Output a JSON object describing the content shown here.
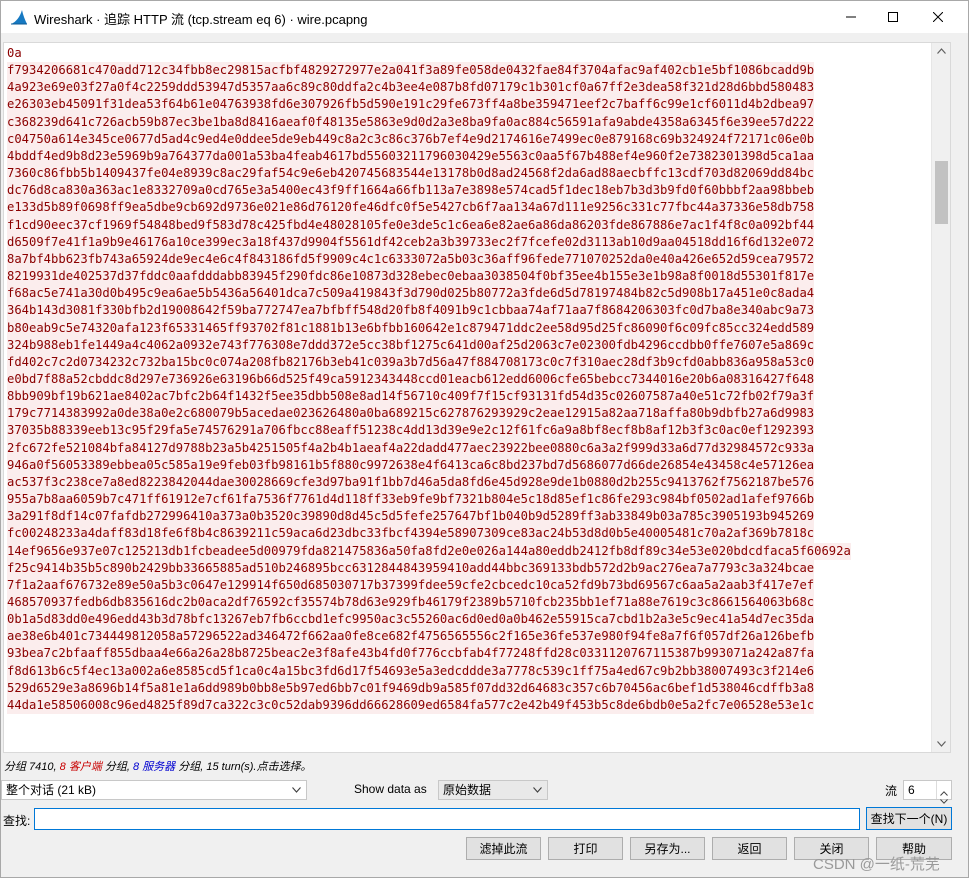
{
  "window": {
    "title": "Wireshark · 追踪 HTTP 流 (tcp.stream eq 6) · wire.pcapng"
  },
  "stream_text": {
    "lines": [
      "0a",
      "f7934206681c470add712c34fbb8ec29815acfbf4829272977e2a041f3a89fe058de0432fae84f3704afac9af402cb1e5bf1086bcadd9b",
      "4a923e69e03f27a0f4c2259ddd53947d5357aa6c89c80ddfa2c4b3ee4e087b8fd07179c1b301cf0a67ff2e3dea58f321d28d6bbd580483",
      "e26303eb45091f31dea53f64b61e04763938fd6e307926fb5d590e191c29fe673ff4a8be359471eef2c7baff6c99e1cf6011d4b2dbea97",
      "c368239d641c726acb59b87ec3be1ba8d8416aeaf0f48135e5863e9d0d2a3e8ba9fa0ac884c56591afa9abde4358a6345f6e39ee57d222",
      "c04750a614e345ce0677d5ad4c9ed4e0ddee5de9eb449c8a2c3c86c376b7ef4e9d2174616e7499ec0e879168c69b324924f72171c06e0b",
      "4bddf4ed9b8d23e5969b9a764377da001a53ba4feab4617bd55603211796030429e5563c0aa5f67b488ef4e960f2e7382301398d5ca1aa",
      "7360c86fbb5b1409437fe04e8939c8ac29faf54c9e6eb420745683544e13178b0d8ad24568f2da6ad88aecbffc13cdf703d82069dd84bc",
      "dc76d8ca830a363ac1e8332709a0cd765e3a5400ec43f9ff1664a66fb113a7e3898e574cad5f1dec18eb7b3d3b9fd0f60bbbf2aa98bbeb",
      "e133d5b89f0698ff9ea5dbe9cb692d9736e021e86d76120fe46dfc0f5e5427cb6f7aa134a67d111e9256c331c77fbc44a37336e58db758",
      "f1cd90eec37cf1969f54848bed9f583d78c425fbd4e48028105fe0e3de5c1c6ea6e82ae6a86da86203fde867886e7ac1f4f8c0a092bf44",
      "d6509f7e41f1a9b9e46176a10ce399ec3a18f437d9904f5561df42ceb2a3b39733ec2f7fcefe02d3113ab10d9aa04518dd16f6d132e072",
      "8a7bf4bb623fb743a65924de9ec4e6c4f843186fd5f9909c4c1c6333072a5b03c36aff96fede771070252da0e40a426e652d59cea79572",
      "8219931de402537d37fddc0aafdddabb83945f290fdc86e10873d328ebec0ebaa3038504f0bf35ee4b155e3e1b98a8f0018d55301f817e",
      "f68ac5e741a30d0b495c9ea6ae5b5436a56401dca7c509a419843f3d790d025b80772a3fde6d5d78197484b82c5d908b17a451e0c8ada4",
      "364b143d3081f330bfb2d19008642f59ba772747ea7bfbff548d20fb8f4091b9c1cbbaa74af71aa7f8684206303fc0d7ba8e340abc9a73",
      "b80eab9c5e74320afa123f65331465ff93702f81c1881b13e6bfbb160642e1c879471ddc2ee58d95d25fc86090f6c09fc85cc324edd589",
      "324b988eb1fe1449a4c4062a0932e743f776308e7ddd372e5cc38bf1275c641d00af25d2063c7e02300fdb4296ccdbb0ffe7607e5a869c",
      "fd402c7c2d0734232c732ba15bc0c074a208fb82176b3eb41c039a3b7d56a47f884708173c0c7f310aec28df3b9cfd0abb836a958a53c0",
      "e0bd7f88a52cbddc8d297e736926e63196b66d525f49ca5912343448ccd01eacb612edd6006cfe65bebcc7344016e20b6a08316427f648",
      "8bb909bf19b621ae8402ac7bfc2b64f1432f5ee35dbb508e8ad14f56710c409f7f15cf93131fd54d35c02607587a40e51c72fb02f79a3f",
      "179c7714383992a0de38a0e2c680079b5acedae023626480a0ba689215c627876293929c2eae12915a82aa718affa80b9dbfb27a6d9983",
      "37035b88339eeb13c95f29fa5e74576291a706fbcc88eaff51238c4dd13d39e9e2c12f61fc6a9a8bf8ecf8b8af12b3f3c0ac0ef1292393",
      "2fc672fe521084bfa84127d9788b23a5b4251505f4a2b4b1aeaf4a22dadd477aec23922bee0880c6a3a2f999d33a6d77d32984572c933a",
      "946a0f56053389ebbea05c585a19e9feb03fb98161b5f880c9972638e4f6413ca6c8bd237bd7d5686077d66de26854e43458c4e57126ea",
      "ac537f3c238ce7a8ed8223842044dae30028669cfe3d97ba91f1bb7d46a5da8fd6e45d928e9de1b0880d2b255c9413762f7562187be576",
      "955a7b8aa6059b7c471ff61912e7cf61fa7536f7761d4d118ff33eb9fe9bf7321b804e5c18d85ef1c86fe293c984bf0502ad1afef9766b",
      "3a291f8df14c07fafdb272996410a373a0b3520c39890d8d45c5d5fefe257647bf1b040b9d5289ff3ab33849b03a785c3905193b945269",
      "fc00248233a4daff83d18fe6f8b4c8639211c59aca6d23dbc33fbcf4394e58907309ce83ac24b53d8d0b5e40005481c70a2af369b7818c",
      "14ef9656e937e07c125213db1fcbeadee5d00979fda821475836a50fa8fd2e0e026a144a80eddb2412fb8df89c34e53e020bdcdfaca5f60692a",
      "f25c9414b35b5c890b2429bb33665885ad510b246895bcc6312844843959410add44bbc369133bdb572d2b9ac276ea7a7793c3a324bcae",
      "7f1a2aaf676732e89e50a5b3c0647e129914f650d685030717b37399fdee59cfe2cbcedc10ca52fd9b73bd69567c6aa5a2aab3f417e7ef",
      "468570937fedb6db835616dc2b0aca2df76592cf35574b78d63e929fb46179f2389b5710fcb235bb1ef71a88e7619c3c8661564063b68c",
      "0b1a5d83dd0e496edd43b3d78bfc13267eb7fb6ccbd1efc9950ac3c55260ac6d0ed0a0b462e55915ca7cbd1b2a3e5c9ec41a54d7ec35da",
      "ae38e6b401c734449812058a57296522ad346472f662aa0fe8ce682f4756565556c2f165e36fe537e980f94fe8a7f6f057df26a126befb",
      "93bea7c2bfaaff855dbaa4e66a26a28b8725beac2e3f8afe43b4fd0f776ccbfab4f77248ffd28c0331120767115387b993071a242a87fa",
      "f8d613b6c5f4ec13a002a6e8585cd5f1ca0c4a15bc3fd6d17f54693e5a3edcddde3a7778c539c1ff75a4ed67c9b2bb38007493c3f214e6",
      "529d6529e3a8696b14f5a81e1a6dd989b0bb8e5b97ed6bb7c01f9469db9a585f07dd32d64683c357c6b70456ac6bef1d538046cdffb3a8",
      "44da1e58506008c96ed4825f89d7ca322c3c0c52dab9396dd66628609ed6584fa577c2e42b49f453b5c8de6bdb0e5a2fc7e06528e53e1c"
    ]
  },
  "status": {
    "prefix": "分组 7410, ",
    "client_count": "8",
    "client_label": "客户端",
    "mid1": " 分组, ",
    "server_count": "8",
    "server_label": "服务器",
    "mid2": " 分组, 15 turn(s).点击选择。"
  },
  "controls": {
    "conversation": "整个对话 (21 kB)",
    "show_data_as_label": "Show data as",
    "show_data_as_value": "原始数据",
    "stream_label": "流",
    "stream_value": "6",
    "find_label": "查找:",
    "find_value": "",
    "find_next_label": "查找下一个(N)"
  },
  "buttons": {
    "filter_out": "滤掉此流",
    "print": "打印",
    "save_as": "另存为...",
    "back": "返回",
    "close": "关闭",
    "help": "帮助"
  },
  "watermark": "CSDN @一纸-荒芜",
  "colors": {
    "server_text": "#8b0000",
    "server_bg": "#fbeded",
    "client_label": "#c80000",
    "server_label": "#0000d0",
    "focus_border": "#0078d7"
  }
}
